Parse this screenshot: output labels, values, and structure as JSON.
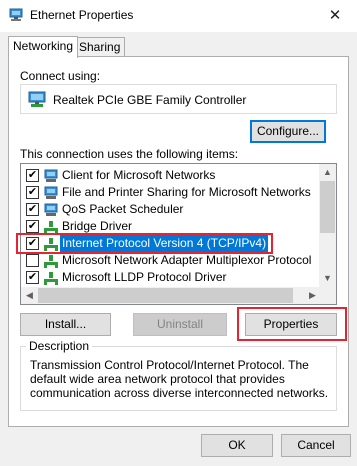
{
  "window": {
    "title": "Ethernet Properties",
    "close_glyph": "✕"
  },
  "tabs": [
    {
      "label": "Networking"
    },
    {
      "label": "Sharing"
    }
  ],
  "connect_using": {
    "label": "Connect using:",
    "adapter": "Realtek PCIe GBE Family Controller",
    "configure_label": "Configure..."
  },
  "items_section": {
    "label": "This connection uses the following items:",
    "items": [
      {
        "label": "Client for Microsoft Networks",
        "checked": true,
        "icon": "network-client-icon"
      },
      {
        "label": "File and Printer Sharing for Microsoft Networks",
        "checked": true,
        "icon": "network-service-icon"
      },
      {
        "label": "QoS Packet Scheduler",
        "checked": true,
        "icon": "network-service-icon"
      },
      {
        "label": "Bridge Driver",
        "checked": true,
        "icon": "network-protocol-icon"
      },
      {
        "label": "Internet Protocol Version 4 (TCP/IPv4)",
        "checked": true,
        "selected": true,
        "icon": "network-protocol-icon"
      },
      {
        "label": "Microsoft Network Adapter Multiplexor Protocol",
        "checked": false,
        "icon": "network-protocol-icon"
      },
      {
        "label": "Microsoft LLDP Protocol Driver",
        "checked": true,
        "icon": "network-protocol-icon"
      }
    ]
  },
  "buttons": {
    "install": "Install...",
    "uninstall": "Uninstall",
    "properties": "Properties",
    "ok": "OK",
    "cancel": "Cancel"
  },
  "description": {
    "legend": "Description",
    "text": "Transmission Control Protocol/Internet Protocol. The default wide area network protocol that provides communication across diverse interconnected networks."
  },
  "colors": {
    "selection": "#0078d7",
    "highlight": "#e8222f",
    "checkmark": "#000000"
  }
}
